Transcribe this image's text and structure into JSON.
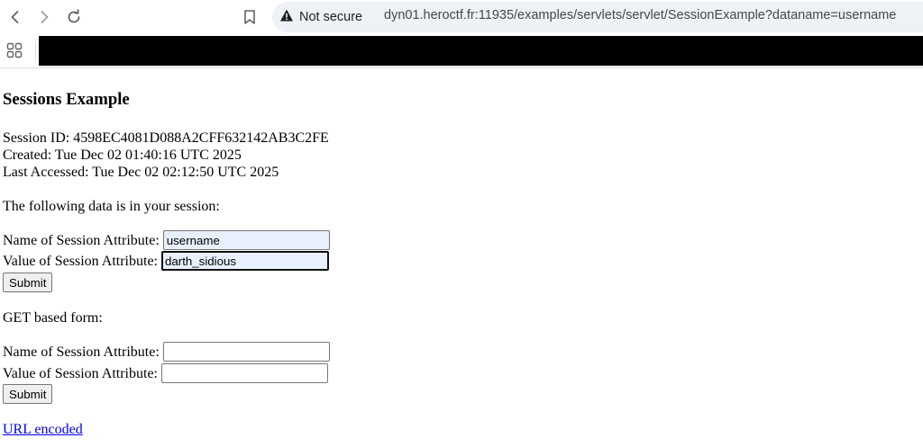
{
  "browser": {
    "security_label": "Not secure",
    "url": "dyn01.heroctf.fr:11935/examples/servlets/servlet/SessionExample?dataname=username"
  },
  "page": {
    "title": "Sessions Example",
    "session_id": "Session ID: 4598EC4081D088A2CFF632142AB3C2FE",
    "created": "Created: Tue Dec 02 01:40:16 UTC 2025",
    "last_accessed": "Last Accessed: Tue Dec 02 02:12:50 UTC 2025",
    "data_intro": "The following data is in your session:",
    "post_form": {
      "name_label": "Name of Session Attribute:",
      "name_value": "username",
      "value_label": "Value of Session Attribute:",
      "value_value": "darth_sidious",
      "submit_label": "Submit"
    },
    "get_heading": "GET based form:",
    "get_form": {
      "name_label": "Name of Session Attribute:",
      "name_value": "",
      "value_label": "Value of Session Attribute:",
      "value_value": "",
      "submit_label": "Submit"
    },
    "url_encoded_link": "URL encoded"
  },
  "colors": {
    "link": "#0000ee",
    "autofill_bg": "#e8f0fe",
    "omnibox_bg": "#eef1f6"
  },
  "icons": [
    "back-icon",
    "forward-icon",
    "reload-icon",
    "bookmark-icon",
    "warning-icon",
    "apps-grid-icon"
  ]
}
